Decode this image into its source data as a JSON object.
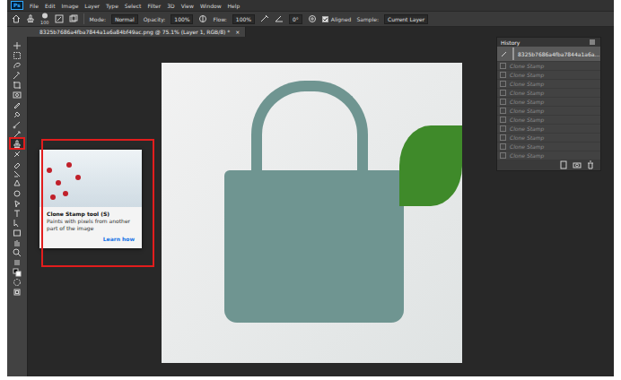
{
  "menu": {
    "logo": "Ps",
    "items": [
      "File",
      "Edit",
      "Image",
      "Layer",
      "Type",
      "Select",
      "Filter",
      "3D",
      "View",
      "Window",
      "Help"
    ]
  },
  "options": {
    "brush_size": "100",
    "mode_label": "Mode:",
    "mode": "Normal",
    "opacity_label": "Opacity:",
    "opacity": "100%",
    "flow_label": "Flow:",
    "flow": "100%",
    "angle": "0°",
    "aligned": {
      "label": "Aligned",
      "checked": true
    },
    "sample_label": "Sample:",
    "sample": "Current Layer"
  },
  "document_tab": {
    "title": "8325b7686a4fba7844a1a6a84bf49ac.png @ 75.1% (Layer 1, RGB/8) *",
    "close": "×"
  },
  "tools": [
    {
      "selected": false,
      "highlighted": false
    },
    {
      "selected": false,
      "highlighted": false
    },
    {
      "selected": false,
      "highlighted": false
    },
    {
      "selected": false,
      "highlighted": false
    },
    {
      "selected": false,
      "highlighted": false
    },
    {
      "selected": false,
      "highlighted": false
    },
    {
      "selected": false,
      "highlighted": false
    },
    {
      "selected": false,
      "highlighted": false
    },
    {
      "selected": false,
      "highlighted": false
    },
    {
      "selected": false,
      "highlighted": false
    },
    {
      "selected": true,
      "highlighted": true
    },
    {
      "selected": false,
      "highlighted": false
    },
    {
      "selected": false,
      "highlighted": false
    },
    {
      "selected": false,
      "highlighted": false
    },
    {
      "selected": false,
      "highlighted": false
    },
    {
      "selected": false,
      "highlighted": false
    },
    {
      "selected": false,
      "highlighted": false
    },
    {
      "selected": false,
      "highlighted": false
    },
    {
      "selected": false,
      "highlighted": false
    },
    {
      "selected": false,
      "highlighted": false
    },
    {
      "selected": false,
      "highlighted": false
    },
    {
      "selected": false,
      "highlighted": false
    },
    {
      "selected": false,
      "highlighted": false
    },
    {
      "selected": false,
      "highlighted": false
    },
    {
      "selected": false,
      "highlighted": false
    },
    {
      "selected": false,
      "highlighted": false
    }
  ],
  "tooltip": {
    "title": "Clone Stamp tool (S)",
    "description": "Paints with pixels from another part of the image",
    "link": "Learn how"
  },
  "history": {
    "title": "History",
    "snapshot": {
      "label": "8325b7686a4fba7844a1a6a...",
      "selected": true
    },
    "steps": [
      {
        "label": "Clone Stamp",
        "dimmed": true
      },
      {
        "label": "Clone Stamp",
        "dimmed": true
      },
      {
        "label": "Clone Stamp",
        "dimmed": true
      },
      {
        "label": "Clone Stamp",
        "dimmed": true
      },
      {
        "label": "Clone Stamp",
        "dimmed": true
      },
      {
        "label": "Clone Stamp",
        "dimmed": true
      },
      {
        "label": "Clone Stamp",
        "dimmed": true
      },
      {
        "label": "Clone Stamp",
        "dimmed": true
      },
      {
        "label": "Clone Stamp",
        "dimmed": true
      },
      {
        "label": "Clone Stamp",
        "dimmed": true
      },
      {
        "label": "Clone Stamp",
        "dimmed": true
      }
    ]
  }
}
